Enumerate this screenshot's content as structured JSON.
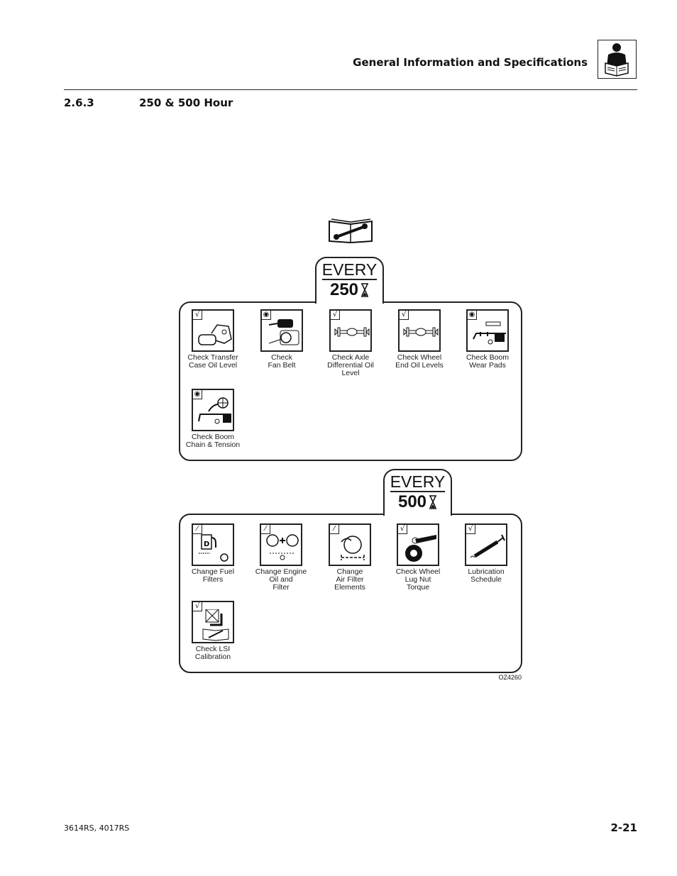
{
  "header": {
    "title": "General Information and Specifications",
    "icon": "operator-reading-manual-icon"
  },
  "section": {
    "number": "2.6.3",
    "title": "250 & 500 Hour"
  },
  "manual_icon": "service-manual-wrench-icon",
  "panels": [
    {
      "every_label": "EVERY",
      "hours": "250",
      "hours_icon": "hourglass-icon",
      "items": [
        {
          "label": "Check Transfer\nCase Oil Level",
          "badge": "check",
          "icon": "transfer-case"
        },
        {
          "label": "Check\nFan Belt",
          "badge": "eye",
          "icon": "fan-belt"
        },
        {
          "label": "Check Axle\nDifferential Oil\nLevel",
          "badge": "check",
          "icon": "axle"
        },
        {
          "label": "Check Wheel\nEnd Oil Levels",
          "badge": "check",
          "icon": "axle"
        },
        {
          "label": "Check Boom\nWear Pads",
          "badge": "eye",
          "icon": "boom-pads"
        },
        {
          "label": "Check Boom\nChain & Tension",
          "badge": "eye",
          "icon": "boom-chain"
        }
      ]
    },
    {
      "every_label": "EVERY",
      "hours": "500",
      "hours_icon": "hourglass-icon",
      "items": [
        {
          "label": "Change Fuel\nFilters",
          "badge": "wrench",
          "icon": "fuel-pump"
        },
        {
          "label": "Change Engine\nOil and\nFilter",
          "badge": "wrench",
          "icon": "engine-oil"
        },
        {
          "label": "Change\nAir Filter\nElements",
          "badge": "wrench",
          "icon": "air-filter"
        },
        {
          "label": "Check Wheel\nLug Nut\nTorque",
          "badge": "check",
          "icon": "wheel-torque"
        },
        {
          "label": "Lubrication\nSchedule",
          "badge": "check",
          "icon": "grease-gun"
        },
        {
          "label": "Check LSI\nCalibration",
          "badge": "check",
          "icon": "lsi"
        }
      ]
    }
  ],
  "figure_id": "OZ4260",
  "footer": {
    "models": "3614RS, 4017RS",
    "page": "2-21"
  }
}
